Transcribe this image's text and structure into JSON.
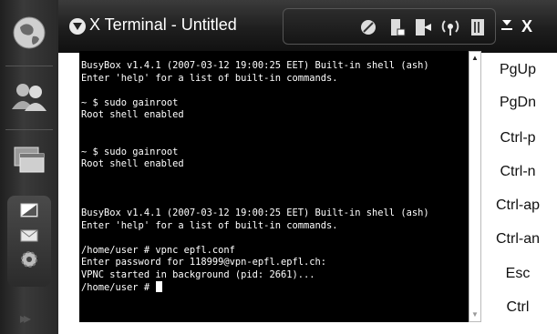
{
  "window": {
    "title": "X Terminal - Untitled",
    "menu_icon": "chevron-down-icon",
    "minimize_label": "⌄",
    "close_label": "X"
  },
  "status_icons": [
    "brightness-icon",
    "battery-icon",
    "network-icon",
    "wireless-icon",
    "memory-icon"
  ],
  "rail": {
    "items": [
      "globe-icon",
      "contacts-icon",
      "windows-icon",
      "tablet-icon",
      "mail-icon",
      "settings-icon"
    ],
    "more_label": "▸▸"
  },
  "terminal": {
    "lines": [
      "BusyBox v1.4.1 (2007-03-12 19:00:25 EET) Built-in shell (ash)",
      "Enter 'help' for a list of built-in commands.",
      "",
      "~ $ sudo gainroot",
      "Root shell enabled",
      "",
      "",
      "~ $ sudo gainroot",
      "Root shell enabled",
      "",
      "",
      "",
      "BusyBox v1.4.1 (2007-03-12 19:00:25 EET) Built-in shell (ash)",
      "Enter 'help' for a list of built-in commands.",
      "",
      "/home/user # vpnc epfl.conf",
      "Enter password for 118999@vpn-epfl.epfl.ch:",
      "VPNC started in background (pid: 2661)...",
      "/home/user # "
    ]
  },
  "keys": [
    "PgUp",
    "PgDn",
    "Ctrl-p",
    "Ctrl-n",
    "Ctrl-ap",
    "Ctrl-an",
    "Esc",
    "Ctrl"
  ],
  "colors": {
    "terminal_bg": "#000000",
    "terminal_fg": "#ffffff",
    "titlebar": "#1e1e1e"
  }
}
